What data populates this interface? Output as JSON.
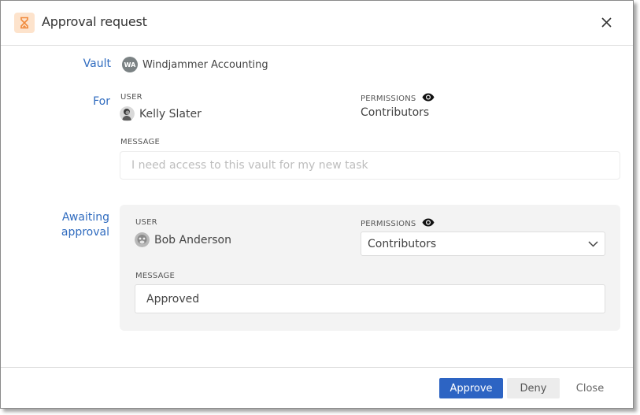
{
  "dialog": {
    "title": "Approval request",
    "header_icon": "hourglass-icon",
    "close_icon": "close-icon",
    "accent_color": "#2d64c3",
    "label_color": "#2f6bbf",
    "header_icon_color": "#f08a3c"
  },
  "vault": {
    "label": "Vault",
    "avatar_initials": "WA",
    "name": "Windjammer Accounting"
  },
  "for": {
    "label": "For",
    "user_caption": "USER",
    "user_name": "Kelly Slater",
    "permissions_caption": "PERMISSIONS",
    "permissions_icon": "eye-icon",
    "permissions_value": "Contributors",
    "message_caption": "MESSAGE",
    "message_value": "I need access to this vault for my new task"
  },
  "awaiting": {
    "label_line1": "Awaiting",
    "label_line2": "approval",
    "user_caption": "USER",
    "user_name": "Bob Anderson",
    "permissions_caption": "PERMISSIONS",
    "permissions_icon": "eye-icon",
    "permissions_selected": "Contributors",
    "message_caption": "MESSAGE",
    "message_value": "Approved"
  },
  "footer": {
    "approve_label": "Approve",
    "deny_label": "Deny",
    "close_label": "Close"
  }
}
